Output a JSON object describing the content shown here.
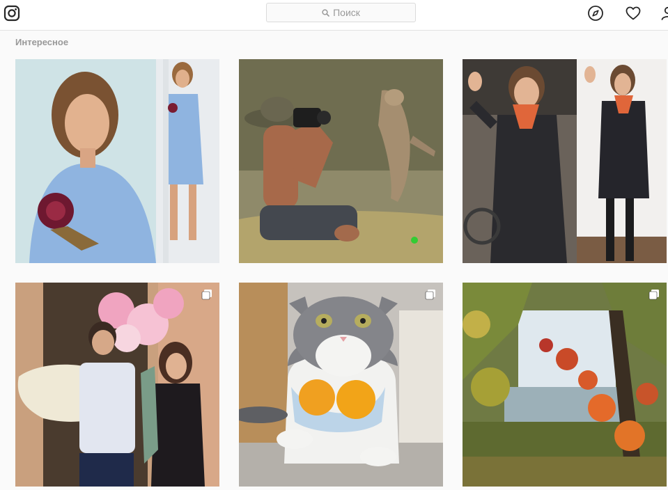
{
  "header": {
    "logo_icon": "instagram-camera-icon",
    "search": {
      "placeholder": "Поиск",
      "icon": "search-icon"
    },
    "nav_icons": [
      "compass-icon",
      "heart-icon",
      "person-icon"
    ]
  },
  "explore": {
    "title": "Интересное",
    "posts": [
      {
        "subject": "woman in light blue dress with rose embroidery",
        "multi": false
      },
      {
        "subject": "boy photographing leaping cat",
        "multi": false
      },
      {
        "subject": "flight attendants saluting",
        "multi": false
      },
      {
        "subject": "couple with baby and balloons",
        "multi": true
      },
      {
        "subject": "grey cat wearing mask with oranges",
        "multi": true
      },
      {
        "subject": "autumn trees by a lake",
        "multi": true
      }
    ]
  },
  "colors": {
    "header_bg": "#ffffff",
    "page_bg": "#fafafa",
    "border": "#e2e2e2",
    "muted_text": "#999999"
  }
}
